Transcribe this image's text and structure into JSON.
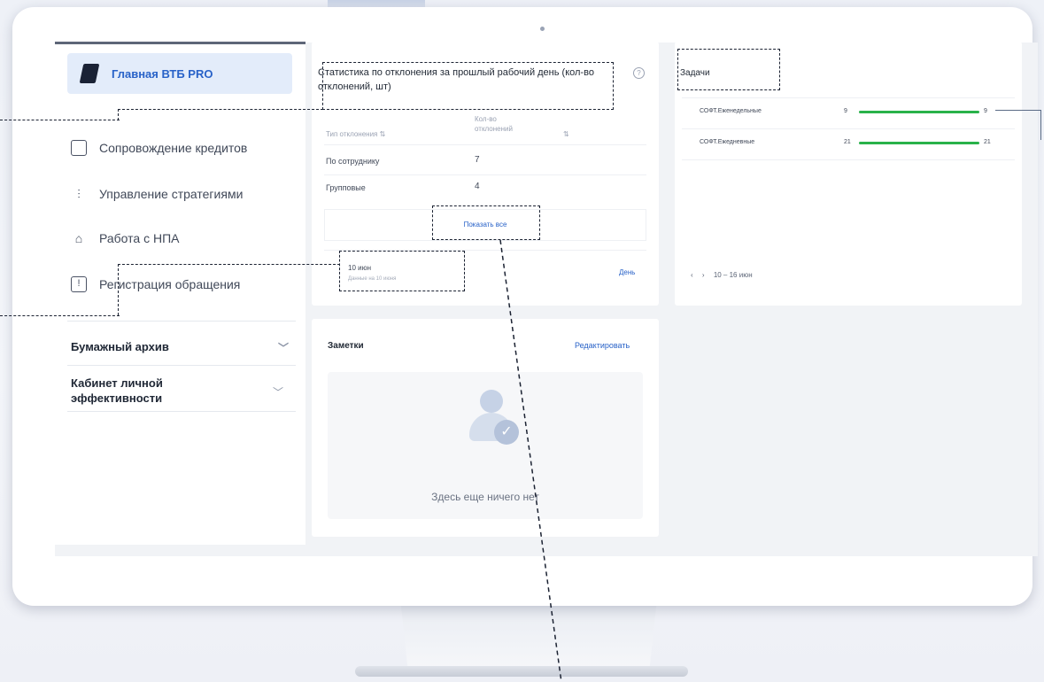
{
  "sidebar": {
    "active_item": "Главная ВТБ PRO",
    "items": [
      {
        "label": "Сопровождение кредитов",
        "icon": "credit-icon"
      },
      {
        "label": "Управление стратегиями",
        "icon": "sliders-icon"
      },
      {
        "label": "Работа с НПА",
        "icon": "bank-icon"
      },
      {
        "label": "Регистрация обращения",
        "icon": "alert-icon"
      }
    ],
    "sections": [
      {
        "label": "Бумажный архив"
      },
      {
        "label": "Кабинет личной эффективности"
      }
    ]
  },
  "stats": {
    "title": "Статистика по отклонения за прошлый рабочий день (кол-во отклонений, шт)",
    "columns": [
      "Тип отклонения",
      "Кол-во отклонений"
    ],
    "rows": [
      {
        "type": "По сотруднику",
        "count": "7"
      },
      {
        "type": "Групповые",
        "count": "4"
      }
    ],
    "show_all": "Показать все",
    "date": "10 июн",
    "date_note": "Данные на 10 июня",
    "period": "День"
  },
  "notes": {
    "title": "Заметки",
    "edit": "Редактировать",
    "empty": "Здесь еще ничего нет"
  },
  "tasks": {
    "title": "Задачи",
    "rows": [
      {
        "name": "СОФТ.Еженедельные",
        "done": "9",
        "total": "9",
        "progress": 1.0
      },
      {
        "name": "СОФТ.Ежедневные",
        "done": "21",
        "total": "21",
        "progress": 1.0
      }
    ],
    "pager": "10 – 16 июн"
  },
  "colors": {
    "accent": "#2862c8",
    "progress": "#29b24a",
    "active_bg": "#e3ecfa"
  }
}
